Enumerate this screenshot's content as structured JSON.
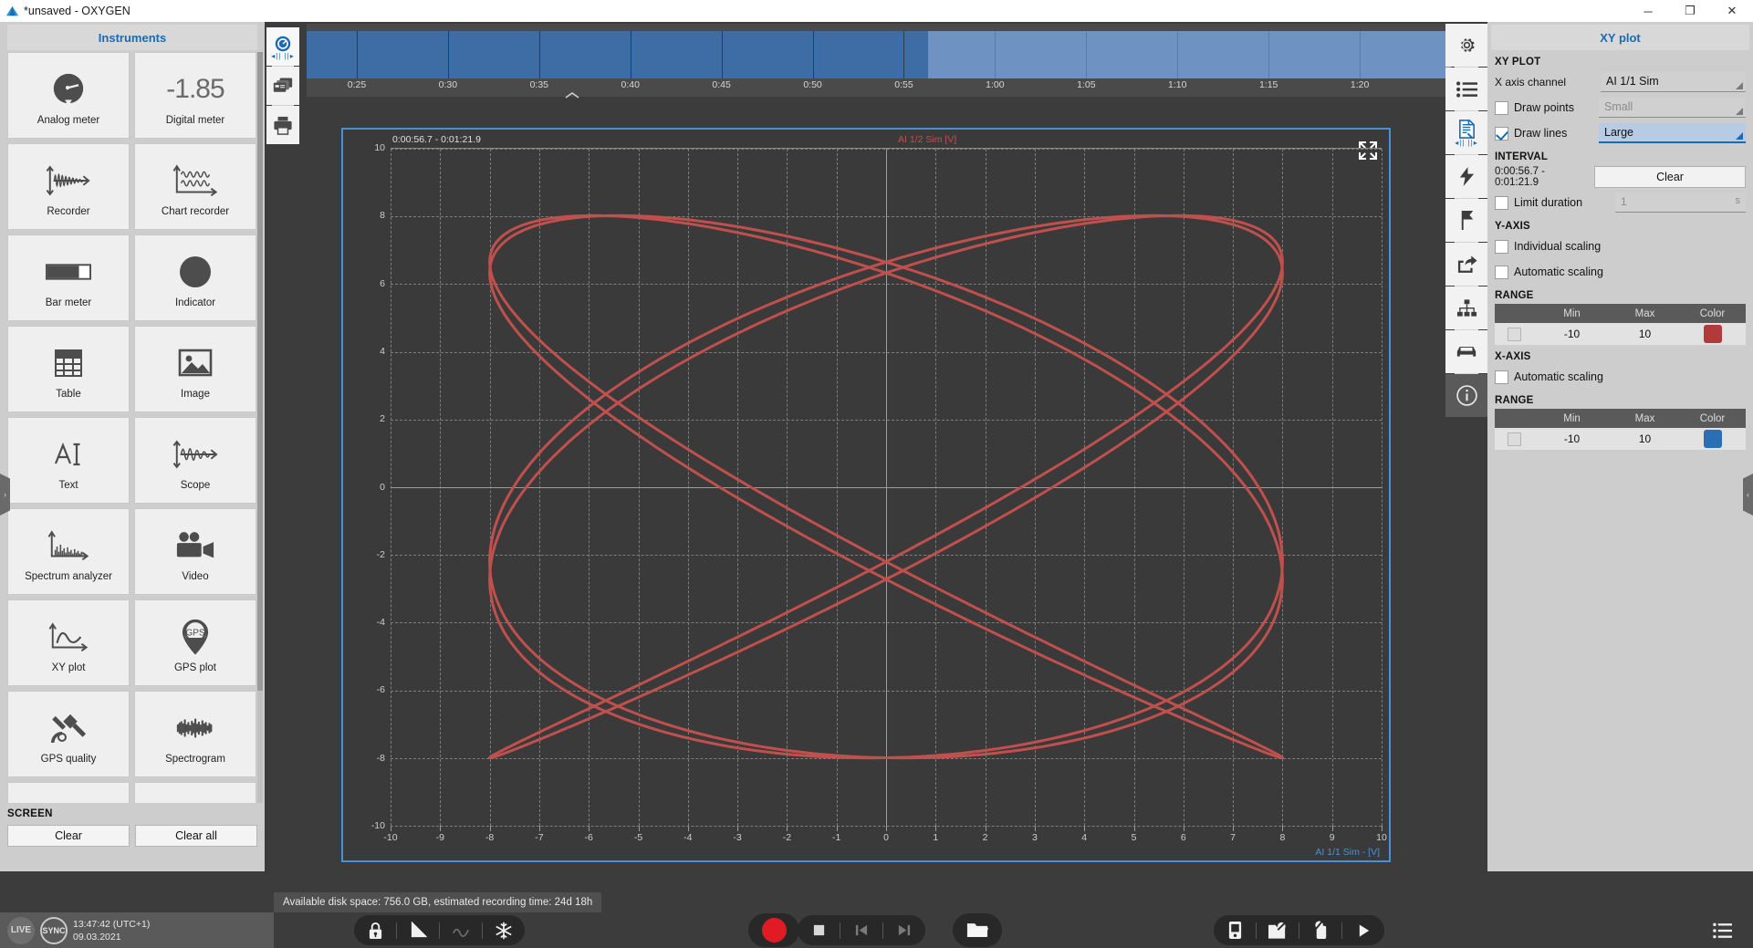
{
  "window": {
    "title": "*unsaved - OXYGEN",
    "logo_icon": "oxygen-logo-icon",
    "minimize_label": "─",
    "maximize_label": "❐",
    "close_label": "✕"
  },
  "instruments_panel": {
    "header": "Instruments",
    "items": [
      {
        "label": "Analog meter",
        "icon": "analog-meter-icon"
      },
      {
        "label": "Digital meter",
        "icon": "digital-meter-icon",
        "value": "-1.85"
      },
      {
        "label": "Recorder",
        "icon": "recorder-icon"
      },
      {
        "label": "Chart recorder",
        "icon": "chart-recorder-icon"
      },
      {
        "label": "Bar meter",
        "icon": "bar-meter-icon"
      },
      {
        "label": "Indicator",
        "icon": "indicator-icon"
      },
      {
        "label": "Table",
        "icon": "table-icon"
      },
      {
        "label": "Image",
        "icon": "image-icon"
      },
      {
        "label": "Text",
        "icon": "text-icon"
      },
      {
        "label": "Scope",
        "icon": "scope-icon"
      },
      {
        "label": "Spectrum analyzer",
        "icon": "spectrum-analyzer-icon"
      },
      {
        "label": "Video",
        "icon": "video-icon"
      },
      {
        "label": "XY plot",
        "icon": "xy-plot-icon"
      },
      {
        "label": "GPS plot",
        "icon": "gps-plot-icon"
      },
      {
        "label": "GPS quality",
        "icon": "gps-quality-icon"
      },
      {
        "label": "Spectrogram",
        "icon": "spectrogram-icon"
      },
      {
        "label": "",
        "icon": "scatter-icon"
      },
      {
        "label": "",
        "icon": "machine-icon"
      }
    ],
    "screen": {
      "section": "SCREEN",
      "clear": "Clear",
      "clear_all": "Clear all"
    },
    "collapse_arrow": "›"
  },
  "mini_toolbar": {
    "items": [
      {
        "icon": "speedometer-icon",
        "selected": true
      },
      {
        "icon": "screens-icon",
        "selected": false
      },
      {
        "icon": "printer-icon",
        "selected": false
      }
    ]
  },
  "timeline": {
    "ticks": [
      "0:25",
      "0:30",
      "0:35",
      "0:40",
      "0:45",
      "0:50",
      "0:55",
      "1:00",
      "1:05",
      "1:10",
      "1:15",
      "1:20"
    ],
    "recorded_fraction": 0.543,
    "collapse_icon": "chevron-up-icon"
  },
  "chart_data": {
    "type": "line",
    "title": "",
    "interval_label": "0:00:56.7 - 0:01:21.9",
    "ylabel": "AI 1/2 Sim [V]",
    "xlabel": "AI 1/1 Sim - [V]",
    "xlim": [
      -10,
      10
    ],
    "ylim": [
      -10,
      10
    ],
    "xticks": [
      -10,
      -9,
      -8,
      -7,
      -6,
      -5,
      -4,
      -3,
      -2,
      -1,
      0,
      1,
      2,
      3,
      4,
      5,
      6,
      7,
      8,
      9,
      10
    ],
    "yticks": [
      10,
      8,
      6,
      4,
      2,
      0,
      -2,
      -4,
      -6,
      -8,
      -10
    ],
    "grid": true,
    "legend": "none",
    "series": [
      {
        "name": "AI 1/2 Sim vs AI 1/1 Sim",
        "color": "#c0504d",
        "description": "Lissajous figure, amplitude 8 V, x/y frequency ratio approximately 5:4",
        "amplitude": 8,
        "fx": 5,
        "fy": 4,
        "phase": 0.35
      }
    ],
    "expand_icon": "expand-icon"
  },
  "icon_rail": {
    "items": [
      {
        "icon": "gear-icon",
        "selected": false,
        "dark": false
      },
      {
        "icon": "list-icon",
        "selected": false,
        "dark": false
      },
      {
        "icon": "document-icon",
        "selected": true,
        "dark": false
      },
      {
        "icon": "lightning-icon",
        "selected": false,
        "dark": false
      },
      {
        "icon": "flag-icon",
        "selected": false,
        "dark": false
      },
      {
        "icon": "share-icon",
        "selected": false,
        "dark": false
      },
      {
        "icon": "network-icon",
        "selected": false,
        "dark": false
      },
      {
        "icon": "car-icon",
        "selected": false,
        "dark": false
      },
      {
        "icon": "info-icon",
        "selected": false,
        "dark": true
      }
    ]
  },
  "settings_panel": {
    "header": "XY plot",
    "xy_plot": {
      "section": "XY PLOT",
      "x_axis_channel_label": "X axis channel",
      "x_axis_channel_value": "AI 1/1 Sim",
      "draw_points_label": "Draw points",
      "draw_points_checked": false,
      "draw_points_size": "Small",
      "draw_lines_label": "Draw lines",
      "draw_lines_checked": true,
      "draw_lines_size": "Large"
    },
    "interval": {
      "section": "INTERVAL",
      "value": "0:00:56.7 - 0:01:21.9",
      "clear_label": "Clear",
      "limit_duration_label": "Limit duration",
      "limit_duration_checked": false,
      "limit_duration_value": "1",
      "limit_duration_unit": "s"
    },
    "y_axis": {
      "section": "Y-AXIS",
      "individual_scaling_label": "Individual scaling",
      "individual_scaling_checked": false,
      "automatic_scaling_label": "Automatic scaling",
      "automatic_scaling_checked": false,
      "range_section": "RANGE",
      "columns": [
        "Min",
        "Max",
        "Color"
      ],
      "rows": [
        {
          "min": "-10",
          "max": "10",
          "color": "#b33a3a",
          "checked": false
        }
      ]
    },
    "x_axis": {
      "section": "X-AXIS",
      "automatic_scaling_label": "Automatic scaling",
      "automatic_scaling_checked": false,
      "range_section": "RANGE",
      "columns": [
        "Min",
        "Max",
        "Color"
      ],
      "rows": [
        {
          "min": "-10",
          "max": "10",
          "color": "#2a6fb5",
          "checked": false
        }
      ]
    },
    "collapse_arrow": "‹"
  },
  "status_bar": {
    "disk_text": "Available disk space: 756.0 GB, estimated recording time: 24d 18h",
    "live_label": "LIVE",
    "sync_label": "SYNC",
    "time": "13:47:42 (UTC+1)",
    "date": "09.03.2021",
    "left_tools": [
      {
        "icon": "lock-icon",
        "dim": false
      },
      {
        "icon": "triangle-icon",
        "dim": false
      },
      {
        "icon": "zigzag-icon",
        "dim": true
      },
      {
        "icon": "snowflake-icon",
        "dim": false
      }
    ],
    "transport": [
      {
        "icon": "stop-icon",
        "dim": false
      },
      {
        "icon": "prev-icon",
        "dim": true
      },
      {
        "icon": "next-icon",
        "dim": true
      }
    ],
    "record_icon": "record-icon",
    "folder_icon": "folder-icon",
    "right_tools": [
      {
        "icon": "device-icon",
        "dim": false
      },
      {
        "icon": "device-config-icon",
        "dim": false
      },
      {
        "icon": "device-settings-icon",
        "dim": false
      },
      {
        "icon": "play-icon",
        "dim": false
      }
    ],
    "menu_icon": "menu-icon"
  }
}
